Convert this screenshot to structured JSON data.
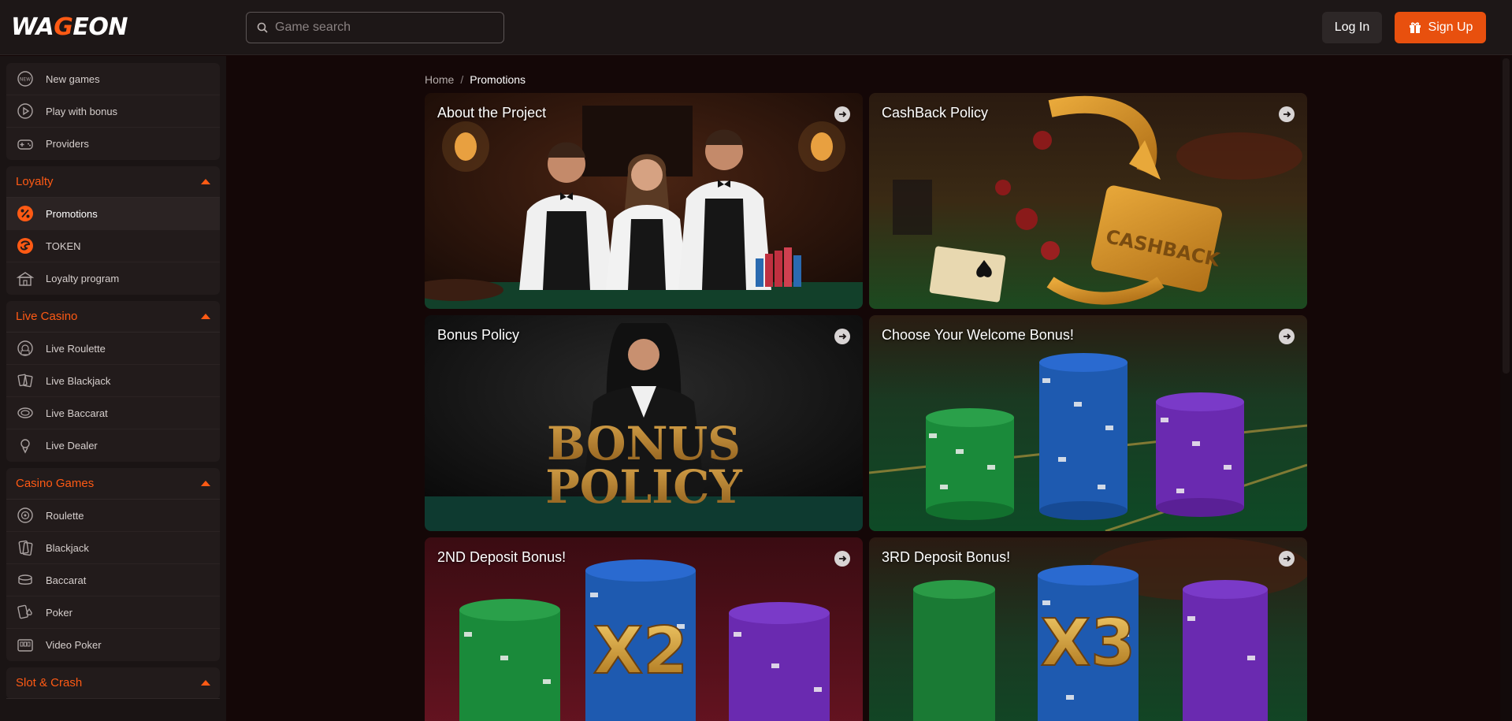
{
  "header": {
    "logo": {
      "part1": "WA",
      "part2": "G",
      "part3": "EON"
    },
    "search_placeholder": "Game search",
    "login_label": "Log In",
    "signup_label": "Sign Up"
  },
  "sidebar": {
    "top_items": [
      {
        "label": "New games",
        "icon": "new-badge-icon"
      },
      {
        "label": "Play with bonus",
        "icon": "play-circle-icon"
      },
      {
        "label": "Providers",
        "icon": "gamepad-icon"
      }
    ],
    "loyalty": {
      "title": "Loyalty",
      "items": [
        {
          "label": "Promotions",
          "icon": "percent-icon"
        },
        {
          "label": "TOKEN",
          "icon": "token-icon"
        },
        {
          "label": "Loyalty program",
          "icon": "building-icon"
        }
      ]
    },
    "live_casino": {
      "title": "Live Casino",
      "items": [
        {
          "label": "Live Roulette",
          "icon": "live-roulette-icon"
        },
        {
          "label": "Live Blackjack",
          "icon": "live-cards-icon"
        },
        {
          "label": "Live Baccarat",
          "icon": "live-baccarat-icon"
        },
        {
          "label": "Live Dealer",
          "icon": "dealer-icon"
        }
      ]
    },
    "casino_games": {
      "title": "Casino Games",
      "items": [
        {
          "label": "Roulette",
          "icon": "roulette-icon"
        },
        {
          "label": "Blackjack",
          "icon": "cards-icon"
        },
        {
          "label": "Baccarat",
          "icon": "baccarat-icon"
        },
        {
          "label": "Poker",
          "icon": "poker-icon"
        },
        {
          "label": "Video Poker",
          "icon": "video-poker-icon"
        }
      ]
    },
    "slot_crash": {
      "title": "Slot & Crash"
    }
  },
  "breadcrumb": {
    "home": "Home",
    "separator": "/",
    "current": "Promotions"
  },
  "promotions": [
    {
      "title": "About the Project"
    },
    {
      "title": "CashBack Policy",
      "art_text": "CASHBACK"
    },
    {
      "title": "Bonus Policy",
      "art_text_1": "BONUS",
      "art_text_2": "POLICY"
    },
    {
      "title": "Choose Your Welcome Bonus!"
    },
    {
      "title": "2ND Deposit Bonus!",
      "art_text": "X2"
    },
    {
      "title": "3RD Deposit Bonus!",
      "art_text": "X3"
    }
  ],
  "colors": {
    "accent": "#ff5a14",
    "signup": "#e8500e",
    "background": "#140707",
    "sidebar": "#1a1414"
  }
}
